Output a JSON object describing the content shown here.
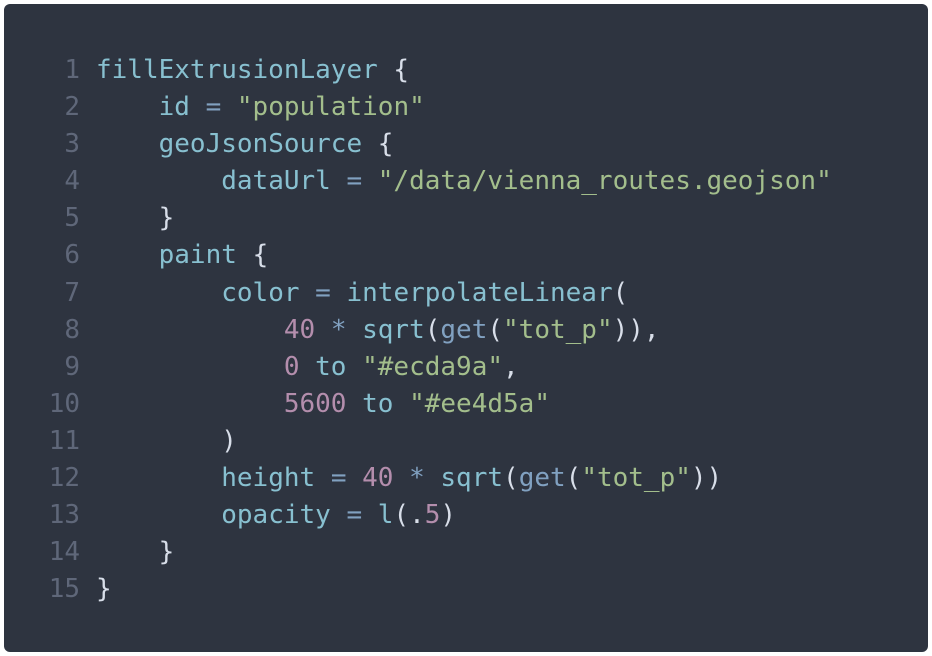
{
  "editor": {
    "language": "kotlin",
    "theme": {
      "background": "#2e3440",
      "line_number": "#5f6779",
      "identifier": "#88c0d0",
      "punctuation": "#d8dee9",
      "operator": "#81a1c1",
      "string": "#a3be8c",
      "number": "#b48ead"
    },
    "lines": [
      {
        "n": "1",
        "tokens": [
          [
            "ident",
            "fillExtrusionLayer"
          ],
          [
            "plain",
            " "
          ],
          [
            "punct",
            "{"
          ]
        ]
      },
      {
        "n": "2",
        "tokens": [
          [
            "plain",
            "    "
          ],
          [
            "ident",
            "id"
          ],
          [
            "plain",
            " "
          ],
          [
            "op",
            "="
          ],
          [
            "plain",
            " "
          ],
          [
            "str",
            "\"population\""
          ]
        ]
      },
      {
        "n": "3",
        "tokens": [
          [
            "plain",
            "    "
          ],
          [
            "ident",
            "geoJsonSource"
          ],
          [
            "plain",
            " "
          ],
          [
            "punct",
            "{"
          ]
        ]
      },
      {
        "n": "4",
        "tokens": [
          [
            "plain",
            "        "
          ],
          [
            "ident",
            "dataUrl"
          ],
          [
            "plain",
            " "
          ],
          [
            "op",
            "="
          ],
          [
            "plain",
            " "
          ],
          [
            "str",
            "\"/data/vienna_routes.geojson\""
          ]
        ]
      },
      {
        "n": "5",
        "tokens": [
          [
            "plain",
            "    "
          ],
          [
            "punct",
            "}"
          ]
        ]
      },
      {
        "n": "6",
        "tokens": [
          [
            "plain",
            "    "
          ],
          [
            "ident",
            "paint"
          ],
          [
            "plain",
            " "
          ],
          [
            "punct",
            "{"
          ]
        ]
      },
      {
        "n": "7",
        "tokens": [
          [
            "plain",
            "        "
          ],
          [
            "ident",
            "color"
          ],
          [
            "plain",
            " "
          ],
          [
            "op",
            "="
          ],
          [
            "plain",
            " "
          ],
          [
            "ident",
            "interpolateLinear"
          ],
          [
            "punct",
            "("
          ]
        ]
      },
      {
        "n": "8",
        "tokens": [
          [
            "plain",
            "            "
          ],
          [
            "num",
            "40"
          ],
          [
            "plain",
            " "
          ],
          [
            "op",
            "*"
          ],
          [
            "plain",
            " "
          ],
          [
            "ident",
            "sqrt"
          ],
          [
            "punct",
            "("
          ],
          [
            "call",
            "get"
          ],
          [
            "punct",
            "("
          ],
          [
            "str",
            "\"tot_p\""
          ],
          [
            "punct",
            ")),"
          ]
        ]
      },
      {
        "n": "9",
        "tokens": [
          [
            "plain",
            "            "
          ],
          [
            "num",
            "0"
          ],
          [
            "plain",
            " "
          ],
          [
            "kw",
            "to"
          ],
          [
            "plain",
            " "
          ],
          [
            "str",
            "\"#ecda9a\""
          ],
          [
            "punct",
            ","
          ]
        ]
      },
      {
        "n": "10",
        "tokens": [
          [
            "plain",
            "            "
          ],
          [
            "num",
            "5600"
          ],
          [
            "plain",
            " "
          ],
          [
            "kw",
            "to"
          ],
          [
            "plain",
            " "
          ],
          [
            "str",
            "\"#ee4d5a\""
          ]
        ]
      },
      {
        "n": "11",
        "tokens": [
          [
            "plain",
            "        "
          ],
          [
            "punct",
            ")"
          ]
        ]
      },
      {
        "n": "12",
        "tokens": [
          [
            "plain",
            "        "
          ],
          [
            "ident",
            "height"
          ],
          [
            "plain",
            " "
          ],
          [
            "op",
            "="
          ],
          [
            "plain",
            " "
          ],
          [
            "num",
            "40"
          ],
          [
            "plain",
            " "
          ],
          [
            "op",
            "*"
          ],
          [
            "plain",
            " "
          ],
          [
            "ident",
            "sqrt"
          ],
          [
            "punct",
            "("
          ],
          [
            "call",
            "get"
          ],
          [
            "punct",
            "("
          ],
          [
            "str",
            "\"tot_p\""
          ],
          [
            "punct",
            "))"
          ]
        ]
      },
      {
        "n": "13",
        "tokens": [
          [
            "plain",
            "        "
          ],
          [
            "ident",
            "opacity"
          ],
          [
            "plain",
            " "
          ],
          [
            "op",
            "="
          ],
          [
            "plain",
            " "
          ],
          [
            "ident",
            "l"
          ],
          [
            "punct",
            "("
          ],
          [
            "punct",
            "."
          ],
          [
            "num",
            "5"
          ],
          [
            "punct",
            ")"
          ]
        ]
      },
      {
        "n": "14",
        "tokens": [
          [
            "plain",
            "    "
          ],
          [
            "punct",
            "}"
          ]
        ]
      },
      {
        "n": "15",
        "tokens": [
          [
            "punct",
            "}"
          ]
        ]
      }
    ]
  }
}
